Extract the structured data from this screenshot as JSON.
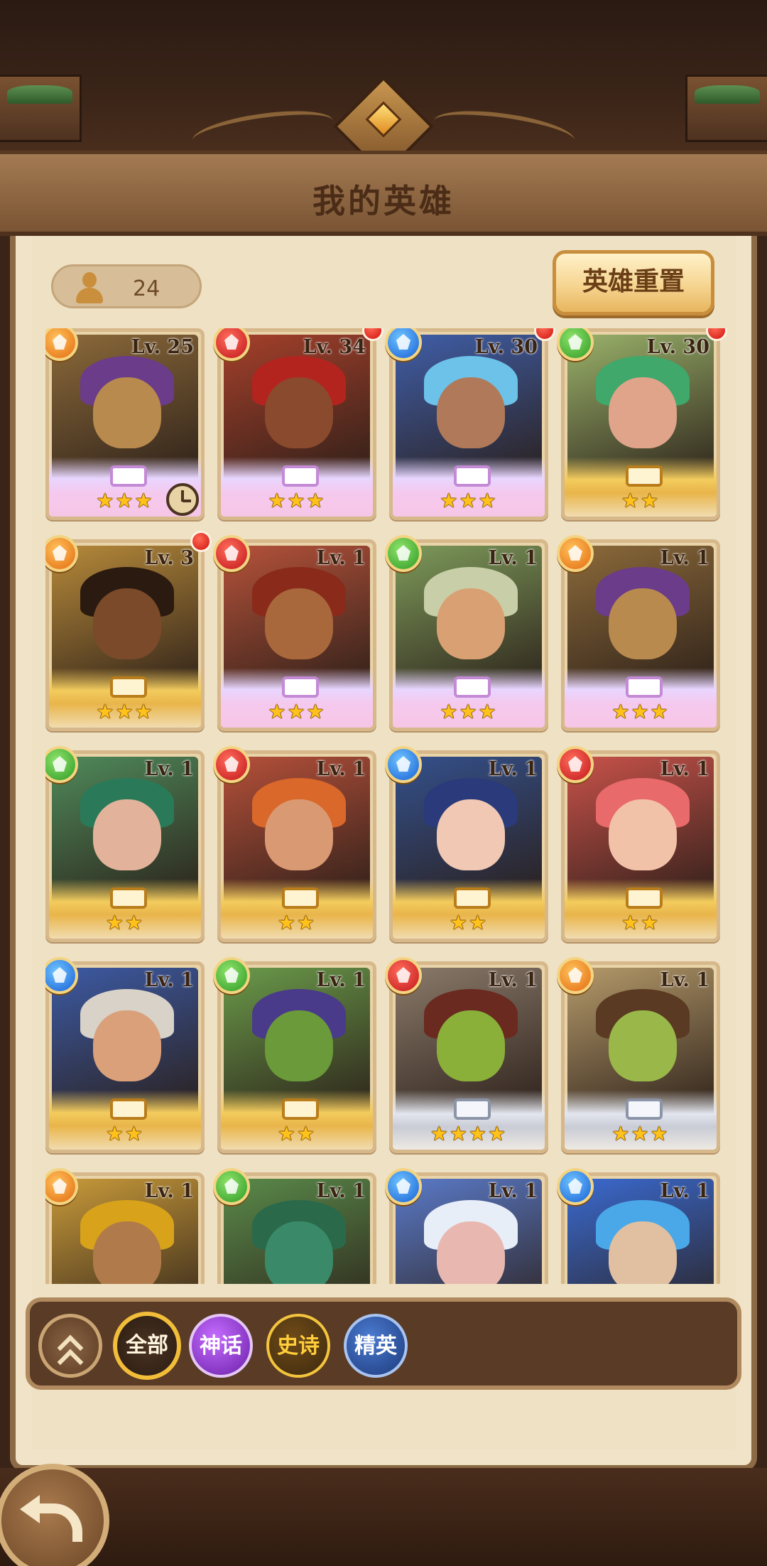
{
  "header": {
    "title": "我的英雄"
  },
  "roster": {
    "hero_count": "24",
    "reset_label": "英雄重置"
  },
  "heroes": [
    {
      "level": "Lv. 25",
      "element": "light",
      "stars": "★★★",
      "frame": "pink",
      "skin": "#b98a4e",
      "hair": "#6a3c8a",
      "bg": "#8c6a3a",
      "new": false,
      "timer": true
    },
    {
      "level": "Lv. 34",
      "element": "fire",
      "stars": "★★★",
      "frame": "pink",
      "skin": "#8a4a2e",
      "hair": "#b3241f",
      "bg": "#a5402b",
      "new": true,
      "timer": false
    },
    {
      "level": "Lv. 30",
      "element": "water",
      "stars": "★★★",
      "frame": "pink",
      "skin": "#b07a5a",
      "hair": "#6cc2e8",
      "bg": "#3f5ea8",
      "new": true,
      "timer": false
    },
    {
      "level": "Lv. 30",
      "element": "earth",
      "stars": "★★",
      "frame": "gold",
      "skin": "#e0a48a",
      "hair": "#3fa86a",
      "bg": "#9ab26a",
      "new": true,
      "timer": false
    },
    {
      "level": "Lv. 3",
      "element": "light",
      "stars": "★★★",
      "frame": "gold",
      "skin": "#7a4a2a",
      "hair": "#2a1a10",
      "bg": "#b78a3a",
      "new": true,
      "timer": false
    },
    {
      "level": "Lv. 1",
      "element": "fire",
      "stars": "★★★",
      "frame": "pink",
      "skin": "#a8683c",
      "hair": "#8a2a1a",
      "bg": "#b5523a",
      "new": false,
      "timer": false
    },
    {
      "level": "Lv. 1",
      "element": "earth",
      "stars": "★★★",
      "frame": "pink",
      "skin": "#d9a073",
      "hair": "#c8cfa8",
      "bg": "#7d9a5a",
      "new": false,
      "timer": false
    },
    {
      "level": "Lv. 1",
      "element": "light",
      "stars": "★★★",
      "frame": "pink",
      "skin": "#b98a4e",
      "hair": "#6a3c8a",
      "bg": "#8c6a3a",
      "new": false,
      "timer": false
    },
    {
      "level": "Lv. 1",
      "element": "earth",
      "stars": "★★",
      "frame": "gold",
      "skin": "#e2b39a",
      "hair": "#2a7a5a",
      "bg": "#4f8a5a",
      "new": false,
      "timer": false
    },
    {
      "level": "Lv. 1",
      "element": "fire",
      "stars": "★★",
      "frame": "gold",
      "skin": "#d99a73",
      "hair": "#d9682a",
      "bg": "#b5503a",
      "new": false,
      "timer": false
    },
    {
      "level": "Lv. 1",
      "element": "water",
      "stars": "★★",
      "frame": "gold",
      "skin": "#f0c8b4",
      "hair": "#2a3a7a",
      "bg": "#34508c",
      "new": false,
      "timer": false
    },
    {
      "level": "Lv. 1",
      "element": "fire",
      "stars": "★★",
      "frame": "gold",
      "skin": "#f2c2a8",
      "hair": "#e86a6a",
      "bg": "#c8524a",
      "new": false,
      "timer": false
    },
    {
      "level": "Lv. 1",
      "element": "water",
      "stars": "★★",
      "frame": "gold",
      "skin": "#d9a07a",
      "hair": "#d8d2c8",
      "bg": "#3c5aa4",
      "new": false,
      "timer": false
    },
    {
      "level": "Lv. 1",
      "element": "earth",
      "stars": "★★",
      "frame": "gold",
      "skin": "#6a9a3a",
      "hair": "#4a3a8a",
      "bg": "#6a9a4a",
      "new": false,
      "timer": false
    },
    {
      "level": "Lv. 1",
      "element": "fire",
      "stars": "★★★★",
      "frame": "silver",
      "skin": "#8ab03a",
      "hair": "#6a2a20",
      "bg": "#8a7a6a",
      "new": false,
      "timer": false
    },
    {
      "level": "Lv. 1",
      "element": "light",
      "stars": "★★★",
      "frame": "silver",
      "skin": "#9ab84a",
      "hair": "#5a3a22",
      "bg": "#b59a6a",
      "new": false,
      "timer": false
    },
    {
      "level": "Lv. 1",
      "element": "light",
      "stars": "",
      "frame": "gold",
      "skin": "#b07a4a",
      "hair": "#d8a21a",
      "bg": "#c89a3a",
      "new": false,
      "timer": false
    },
    {
      "level": "Lv. 1",
      "element": "earth",
      "stars": "",
      "frame": "gold",
      "skin": "#3a8a6a",
      "hair": "#2a6a4a",
      "bg": "#5a8a4a",
      "new": false,
      "timer": false
    },
    {
      "level": "Lv. 1",
      "element": "water",
      "stars": "",
      "frame": "gold",
      "skin": "#e8b8b0",
      "hair": "#e8eef8",
      "bg": "#5a7ac8",
      "new": false,
      "timer": false
    },
    {
      "level": "Lv. 1",
      "element": "water",
      "stars": "",
      "frame": "gold",
      "skin": "#e0c0a0",
      "hair": "#4aa8e8",
      "bg": "#3a6ad0",
      "new": false,
      "timer": false
    }
  ],
  "filters": {
    "all": "全部",
    "myth": "神话",
    "epic": "史诗",
    "elite": "精英"
  }
}
